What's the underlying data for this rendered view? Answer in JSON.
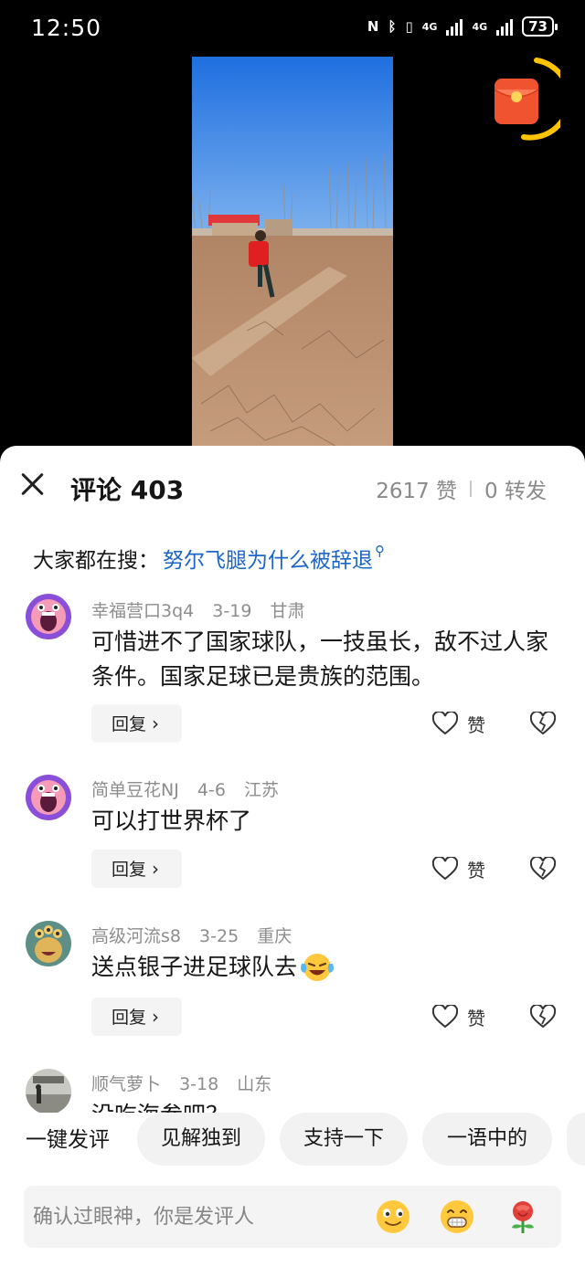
{
  "status_bar": {
    "time": "12:50",
    "network_1": "4G",
    "network_2": "4G",
    "battery": "73"
  },
  "sheet": {
    "title": "评论 403",
    "likes": "2617 赞",
    "shares": "0 转发"
  },
  "trending": {
    "prefix": "大家都在搜：",
    "query": "努尔飞腿为什么被辞退"
  },
  "comments": [
    {
      "user": "幸福营口3q4",
      "date": "3-19",
      "location": "甘肃",
      "text": "可惜进不了国家球队，一技虽长，敌不过人家条件。国家足球已是贵族的范围。",
      "reply_label": "回复",
      "like_label": "赞"
    },
    {
      "user": "简单豆花NJ",
      "date": "4-6",
      "location": "江苏",
      "text": "可以打世界杯了",
      "reply_label": "回复",
      "like_label": "赞"
    },
    {
      "user": "高级河流s8",
      "date": "3-25",
      "location": "重庆",
      "text": "送点银子进足球队去",
      "reply_label": "回复",
      "like_label": "赞"
    },
    {
      "user": "顺气萝卜",
      "date": "3-18",
      "location": "山东",
      "text": "没吃海参吧？"
    }
  ],
  "quick_reply": {
    "label": "一键发评",
    "chips": [
      "见解独到",
      "支持一下",
      "一语中的"
    ]
  },
  "input": {
    "placeholder": "确认过眼神，你是发评人"
  },
  "icons": {
    "close": "close-icon",
    "search": "search-icon",
    "heart": "heart-icon",
    "dislike": "broken-heart-icon",
    "chevron": "chevron-right-icon",
    "red_packet": "red-packet-icon"
  },
  "colors": {
    "link": "#1c66c7",
    "meta": "#8d8d8d",
    "red_packet": "#f0532f",
    "ring": "#ffc400"
  }
}
